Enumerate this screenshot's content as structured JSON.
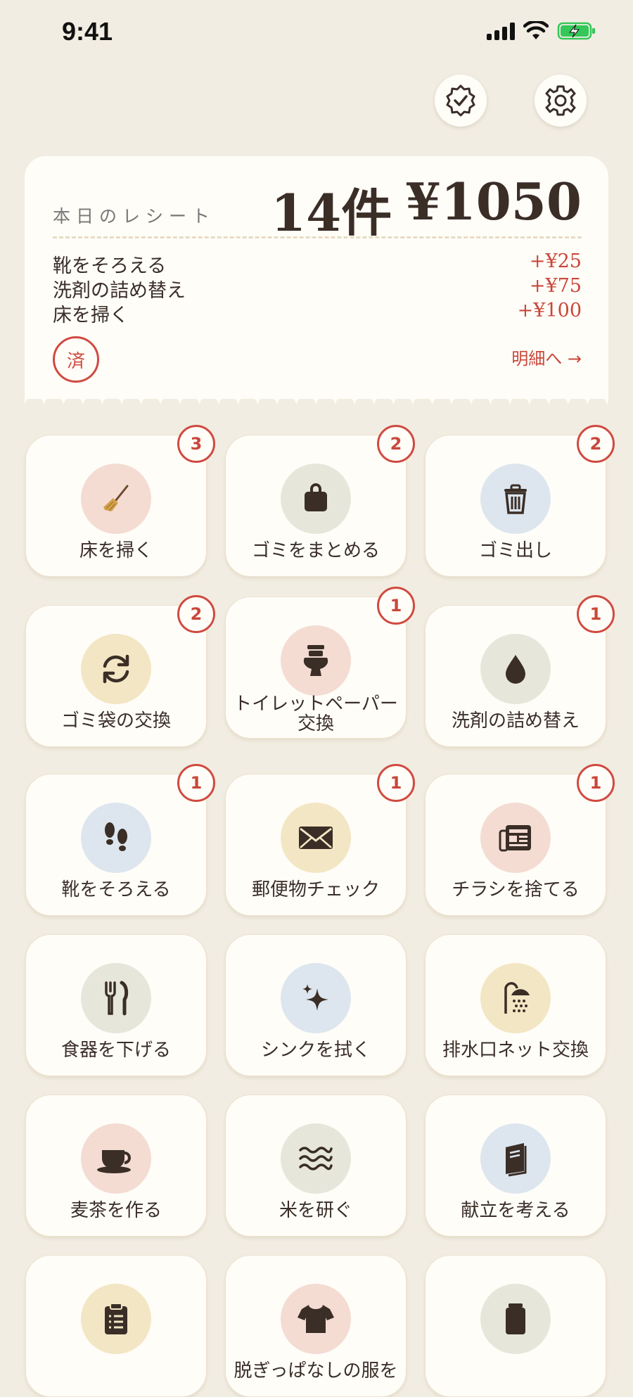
{
  "status": {
    "time": "9:41"
  },
  "receipt": {
    "title": "本日のレシート",
    "count": "14件",
    "total": "¥1050",
    "lines": [
      {
        "name": "靴をそろえる",
        "amount": "+¥25"
      },
      {
        "name": "洗剤の詰め替え",
        "amount": "+¥75"
      },
      {
        "name": "床を掃く",
        "amount": "+¥100"
      }
    ],
    "stamp": "済",
    "detail_link": "明細へ →"
  },
  "colors": {
    "background": "#f2ede2",
    "card": "#fffdf8",
    "accent": "#c9473a",
    "text": "#3a2e27"
  },
  "tasks": [
    {
      "label": "床を掃く",
      "icon": "broom-icon",
      "badge": "3"
    },
    {
      "label": "ゴミをまとめる",
      "icon": "bag-icon",
      "badge": "2"
    },
    {
      "label": "ゴミ出し",
      "icon": "trash-icon",
      "badge": "2"
    },
    {
      "label": "ゴミ袋の交換",
      "icon": "refresh-icon",
      "badge": "2"
    },
    {
      "label": "トイレットペーパー交換",
      "label1": "トイレットペーパー",
      "label2": "交換",
      "icon": "toilet-icon",
      "badge": "1"
    },
    {
      "label": "洗剤の詰め替え",
      "icon": "drop-icon",
      "badge": "1"
    },
    {
      "label": "靴をそろえる",
      "icon": "footprints-icon",
      "badge": "1"
    },
    {
      "label": "郵便物チェック",
      "icon": "envelope-icon",
      "badge": "1"
    },
    {
      "label": "チラシを捨てる",
      "icon": "newspaper-icon",
      "badge": "1"
    },
    {
      "label": "食器を下げる",
      "icon": "utensils-icon"
    },
    {
      "label": "シンクを拭く",
      "icon": "sparkle-icon"
    },
    {
      "label": "排水口ネット交換",
      "icon": "shower-icon"
    },
    {
      "label": "麦茶を作る",
      "icon": "cup-icon"
    },
    {
      "label": "米を研ぐ",
      "icon": "water-icon"
    },
    {
      "label": "献立を考える",
      "icon": "book-icon"
    },
    {
      "label": "",
      "icon": "clipboard-icon"
    },
    {
      "label": "脱ぎっぱなしの服を",
      "icon": "shirt-icon"
    },
    {
      "label": "",
      "icon": "jar-icon"
    }
  ]
}
